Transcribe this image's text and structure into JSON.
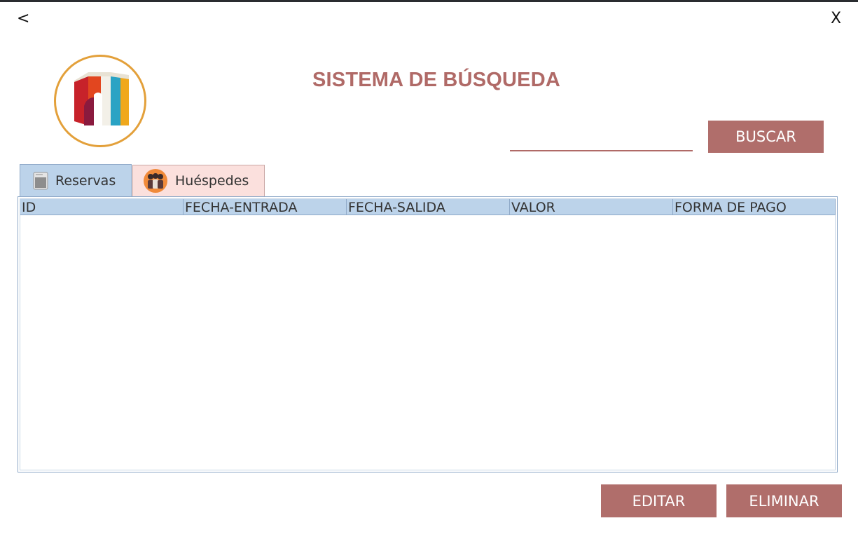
{
  "window": {
    "back_label": "<",
    "close_label": "X"
  },
  "header": {
    "title": "SISTEMA DE BÚSQUEDA"
  },
  "search": {
    "value": "",
    "button_label": "BUSCAR"
  },
  "tabs": [
    {
      "label": "Reservas",
      "icon": "document-icon"
    },
    {
      "label": "Huéspedes",
      "icon": "guests-icon"
    }
  ],
  "table": {
    "columns": [
      "ID",
      "FECHA-ENTRADA",
      "FECHA-SALIDA",
      "VALOR",
      "FORMA DE PAGO"
    ],
    "rows": []
  },
  "actions": {
    "edit_label": "EDITAR",
    "delete_label": "ELIMINAR"
  },
  "colors": {
    "accent": "#b06e6b",
    "tab_active": "#bcd3ea",
    "tab_inactive": "#fbe0dd",
    "logo_ring": "#e3a03a"
  }
}
